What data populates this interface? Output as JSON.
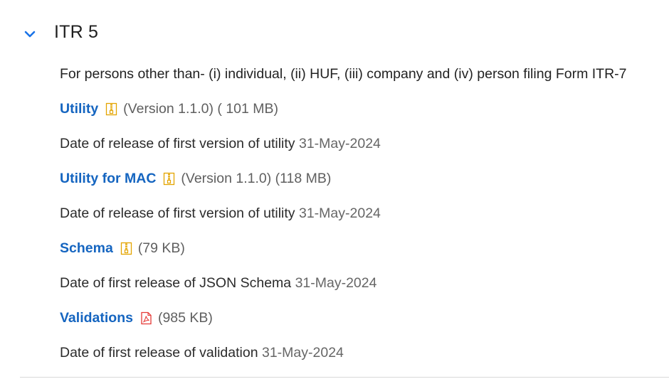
{
  "section": {
    "title": "ITR 5",
    "expanded": true
  },
  "description": "For persons other than- (i) individual, (ii) HUF, (iii) company and (iv) person filing Form ITR-7",
  "utility": {
    "label": "Utility",
    "icon": "zip-file-icon",
    "meta": "(Version 1.1.0) ( 101 MB)",
    "release_text": "Date of release of first version of utility",
    "release_date": "31-May-2024"
  },
  "utility_mac": {
    "label": "Utility for MAC",
    "icon": "zip-file-icon",
    "meta": "(Version 1.1.0) (118 MB)",
    "release_text": "Date of release of first version of utility",
    "release_date": "31-May-2024"
  },
  "schema": {
    "label": "Schema",
    "icon": "zip-file-icon",
    "meta": "(79 KB)",
    "release_text": "Date of first release of JSON Schema",
    "release_date": "31-May-2024"
  },
  "validations": {
    "label": "Validations",
    "icon": "pdf-file-icon",
    "meta": "(985 KB)",
    "release_text": "Date of first release of validation",
    "release_date": "31-May-2024"
  },
  "colors": {
    "link": "#1565c0",
    "chevron": "#1a73e8",
    "zip_icon": "#e3a400",
    "pdf_icon": "#e53935"
  }
}
